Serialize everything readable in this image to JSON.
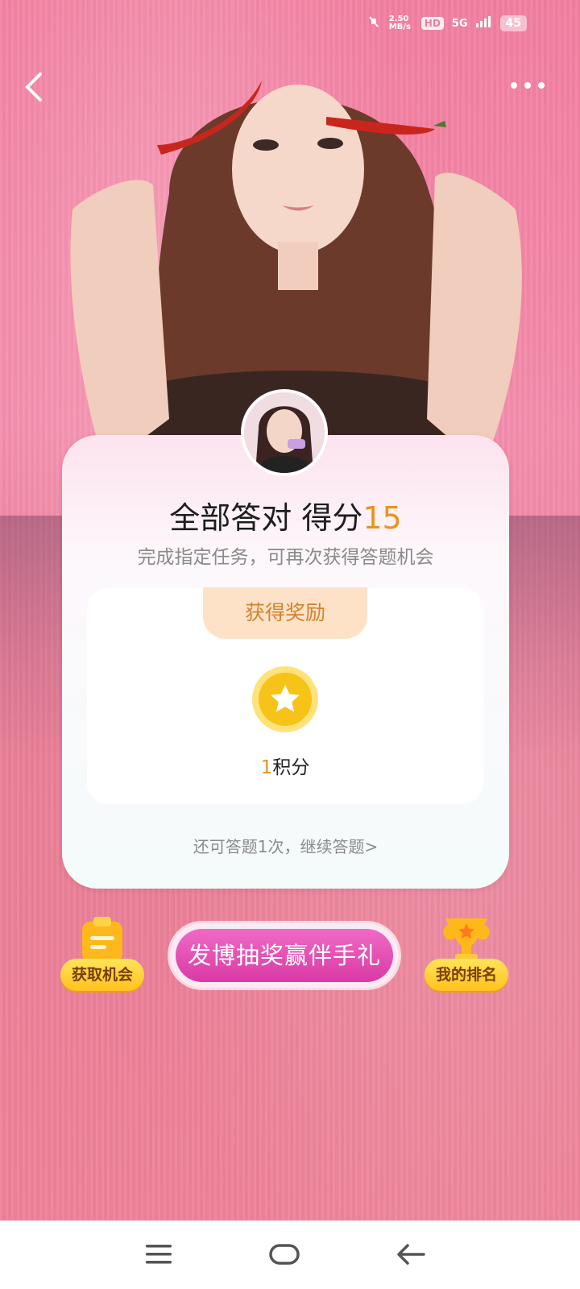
{
  "status_bar": {
    "speed": "2.50 MB/s",
    "hd": "HD",
    "network": "5G",
    "battery": "45"
  },
  "result": {
    "title_prefix": "全部答对 得分",
    "score": "15",
    "subtitle": "完成指定任务，可再次获得答题机会"
  },
  "reward": {
    "tab_label": "获得奖励",
    "points_value": "1",
    "points_unit": "积分"
  },
  "continue_text": "还可答题1次，继续答题>",
  "actions": {
    "get_chance_label": "获取机会",
    "main_label": "发博抽奖赢伴手礼",
    "ranking_label": "我的排名"
  },
  "colors": {
    "accent_orange": "#e8941c",
    "pink_button": "#e04fb4",
    "background_pink": "#f27fa0"
  }
}
